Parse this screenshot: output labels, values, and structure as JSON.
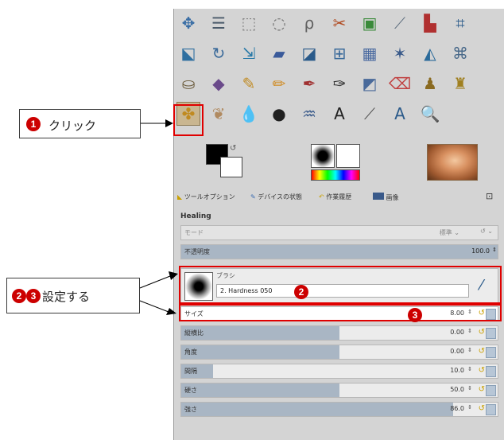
{
  "callouts": {
    "click": {
      "number": "1",
      "label": "クリック"
    },
    "setup": {
      "numbers": [
        "2",
        "3"
      ],
      "label": "設定する"
    },
    "brush_marker": "2",
    "size_marker": "3"
  },
  "tabs": {
    "tool_options": "ツールオプション",
    "device_status": "デバイスの状態",
    "undo_history": "作業履歴",
    "images": "画像"
  },
  "options": {
    "title": "Healing",
    "mode_label": "モード",
    "mode_value": "標準",
    "opacity_label": "不透明度",
    "opacity_value": "100.0",
    "brush_label": "ブラシ",
    "brush_value": "2. Hardness 050",
    "rows": [
      {
        "label": "サイズ",
        "value": "8.00",
        "fill": 0.0
      },
      {
        "label": "縦横比",
        "value": "0.00",
        "fill": 0.5
      },
      {
        "label": "角度",
        "value": "0.00",
        "fill": 0.5
      },
      {
        "label": "間隔",
        "value": "10.0",
        "fill": 0.1
      },
      {
        "label": "硬さ",
        "value": "50.0",
        "fill": 0.5
      },
      {
        "label": "強さ",
        "value": "86.0",
        "fill": 0.86
      }
    ]
  },
  "colors": {
    "foreground": "#000000",
    "background": "#ffffff",
    "accent_red": "#e00000"
  },
  "tools": [
    {
      "name": "move-tool-icon",
      "glyph": "✥",
      "color": "#3a6ea5"
    },
    {
      "name": "align-tool-icon",
      "glyph": "☰",
      "color": "#4a5a6a"
    },
    {
      "name": "rect-select-icon",
      "glyph": "⬚",
      "color": "#808080"
    },
    {
      "name": "ellipse-select-icon",
      "glyph": "◌",
      "color": "#707070"
    },
    {
      "name": "lasso-select-icon",
      "glyph": "ρ",
      "color": "#606060"
    },
    {
      "name": "fuzzy-select-icon",
      "glyph": "✂",
      "color": "#b04a20"
    },
    {
      "name": "color-select-icon",
      "glyph": "▣",
      "color": "#3a8a3a"
    },
    {
      "name": "scissors-select-icon",
      "glyph": "⟋",
      "color": "#607080"
    },
    {
      "name": "foreground-select-icon",
      "glyph": "▙",
      "color": "#b03030"
    },
    {
      "name": "crop-tool-icon",
      "glyph": "⌗",
      "color": "#2a5a8a"
    },
    {
      "name": "unified-transform-icon",
      "glyph": "⬕",
      "color": "#2f6fa0"
    },
    {
      "name": "rotate-tool-icon",
      "glyph": "↻",
      "color": "#3a6a9a"
    },
    {
      "name": "scale-tool-icon",
      "glyph": "⇲",
      "color": "#2a7aa8"
    },
    {
      "name": "shear-tool-icon",
      "glyph": "▰",
      "color": "#3a5a9a"
    },
    {
      "name": "perspective-tool-icon",
      "glyph": "◪",
      "color": "#2a5a8a"
    },
    {
      "name": "flip-tool-icon",
      "glyph": "⊞",
      "color": "#3a6a9a"
    },
    {
      "name": "cage-transform-icon",
      "glyph": "▦",
      "color": "#4a6aa0"
    },
    {
      "name": "warp-transform-icon",
      "glyph": "✶",
      "color": "#3a5a8a"
    },
    {
      "name": "handle-transform-icon",
      "glyph": "◭",
      "color": "#2a6a9a"
    },
    {
      "name": "n-point-deform-icon",
      "glyph": "⌘",
      "color": "#4a6a8a"
    },
    {
      "name": "bucket-fill-icon",
      "glyph": "⛀",
      "color": "#6a5a3a"
    },
    {
      "name": "gradient-tool-icon",
      "glyph": "◆",
      "color": "#6a4a8a"
    },
    {
      "name": "paintbrush-icon",
      "glyph": "✎",
      "color": "#c08a20"
    },
    {
      "name": "pencil-icon",
      "glyph": "✏",
      "color": "#d08a20"
    },
    {
      "name": "airbrush-icon",
      "glyph": "✒",
      "color": "#a03030"
    },
    {
      "name": "ink-tool-icon",
      "glyph": "✑",
      "color": "#303030"
    },
    {
      "name": "mypaint-brush-icon",
      "glyph": "◩",
      "color": "#4a6a9a"
    },
    {
      "name": "eraser-icon",
      "glyph": "⌫",
      "color": "#c04040"
    },
    {
      "name": "clone-tool-icon",
      "glyph": "♟",
      "color": "#8a6a20"
    },
    {
      "name": "perspective-clone-icon",
      "glyph": "♜",
      "color": "#a08020"
    },
    {
      "name": "healing-tool-icon",
      "glyph": "✤",
      "color": "#c08a20"
    },
    {
      "name": "smudge-tool-icon",
      "glyph": "❦",
      "color": "#b08a60"
    },
    {
      "name": "blur-sharpen-icon",
      "glyph": "💧",
      "color": "#2a6ab0"
    },
    {
      "name": "dodge-burn-icon",
      "glyph": "●",
      "color": "#202020"
    },
    {
      "name": "paths-tool-icon",
      "glyph": "♒",
      "color": "#3a5a8a"
    },
    {
      "name": "text-tool-icon",
      "glyph": "A",
      "color": "#202020"
    },
    {
      "name": "color-picker-icon",
      "glyph": "⟋",
      "color": "#505050"
    },
    {
      "name": "measure-tool-icon",
      "glyph": "A",
      "color": "#2a5a8a"
    },
    {
      "name": "zoom-tool-icon",
      "glyph": "🔍",
      "color": "#2a6ab0"
    }
  ]
}
